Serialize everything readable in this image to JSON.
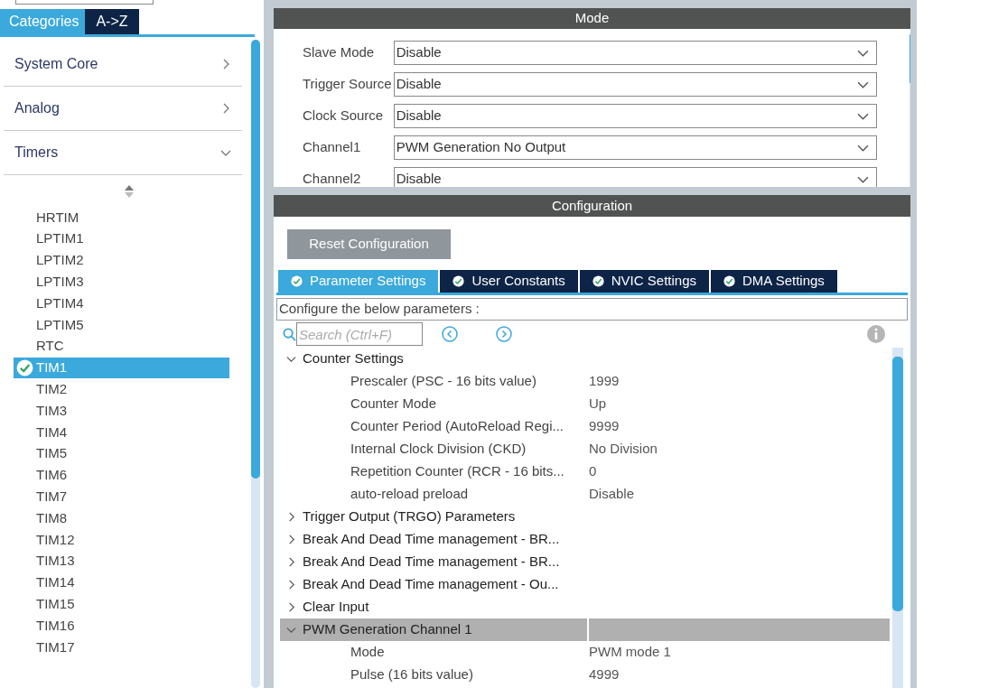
{
  "sidebar": {
    "tabs": [
      {
        "label": "Categories",
        "selected": true
      },
      {
        "label": "A->Z",
        "selected": false
      }
    ],
    "categories": [
      {
        "label": "System Core",
        "expanded": false
      },
      {
        "label": "Analog",
        "expanded": false
      },
      {
        "label": "Timers",
        "expanded": true
      }
    ],
    "items": [
      {
        "label": "HRTIM",
        "selected": false,
        "configured": false
      },
      {
        "label": "LPTIM1",
        "selected": false,
        "configured": false
      },
      {
        "label": "LPTIM2",
        "selected": false,
        "configured": false
      },
      {
        "label": "LPTIM3",
        "selected": false,
        "configured": false
      },
      {
        "label": "LPTIM4",
        "selected": false,
        "configured": false
      },
      {
        "label": "LPTIM5",
        "selected": false,
        "configured": false
      },
      {
        "label": "RTC",
        "selected": false,
        "configured": false
      },
      {
        "label": "TIM1",
        "selected": true,
        "configured": true
      },
      {
        "label": "TIM2",
        "selected": false,
        "configured": false
      },
      {
        "label": "TIM3",
        "selected": false,
        "configured": false
      },
      {
        "label": "TIM4",
        "selected": false,
        "configured": false
      },
      {
        "label": "TIM5",
        "selected": false,
        "configured": false
      },
      {
        "label": "TIM6",
        "selected": false,
        "configured": false
      },
      {
        "label": "TIM7",
        "selected": false,
        "configured": false
      },
      {
        "label": "TIM8",
        "selected": false,
        "configured": false
      },
      {
        "label": "TIM12",
        "selected": false,
        "configured": false
      },
      {
        "label": "TIM13",
        "selected": false,
        "configured": false
      },
      {
        "label": "TIM14",
        "selected": false,
        "configured": false
      },
      {
        "label": "TIM15",
        "selected": false,
        "configured": false
      },
      {
        "label": "TIM16",
        "selected": false,
        "configured": false
      },
      {
        "label": "TIM17",
        "selected": false,
        "configured": false
      }
    ]
  },
  "mode": {
    "title": "Mode",
    "fields": [
      {
        "label": "Slave Mode",
        "value": "Disable"
      },
      {
        "label": "Trigger Source",
        "value": "Disable"
      },
      {
        "label": "Clock Source",
        "value": "Disable"
      },
      {
        "label": "Channel1",
        "value": "PWM Generation No Output"
      },
      {
        "label": "Channel2",
        "value": "Disable"
      }
    ]
  },
  "configuration": {
    "title": "Configuration",
    "reset_button": "Reset Configuration",
    "tabs": [
      {
        "label": "Parameter Settings",
        "selected": true
      },
      {
        "label": "User Constants",
        "selected": false
      },
      {
        "label": "NVIC Settings",
        "selected": false
      },
      {
        "label": "DMA Settings",
        "selected": false
      }
    ],
    "hint": "Configure the below parameters :",
    "search": {
      "placeholder": "Search (Ctrl+F)"
    },
    "groups": [
      {
        "label": "Counter Settings",
        "expanded": true,
        "selected": false,
        "children": [
          {
            "label": "Prescaler (PSC - 16 bits value)",
            "value": "1999"
          },
          {
            "label": "Counter Mode",
            "value": "Up"
          },
          {
            "label": "Counter Period (AutoReload Regi...",
            "value": "9999"
          },
          {
            "label": "Internal Clock Division (CKD)",
            "value": "No Division"
          },
          {
            "label": "Repetition Counter (RCR - 16 bits...",
            "value": "0"
          },
          {
            "label": "auto-reload preload",
            "value": "Disable"
          }
        ]
      },
      {
        "label": "Trigger Output (TRGO) Parameters",
        "expanded": false,
        "selected": false
      },
      {
        "label": "Break And Dead Time management - BR...",
        "expanded": false,
        "selected": false
      },
      {
        "label": "Break And Dead Time management - BR...",
        "expanded": false,
        "selected": false
      },
      {
        "label": "Break And Dead Time management - Ou...",
        "expanded": false,
        "selected": false
      },
      {
        "label": "Clear Input",
        "expanded": false,
        "selected": false
      },
      {
        "label": "PWM Generation Channel 1",
        "expanded": true,
        "selected": true,
        "children": [
          {
            "label": "Mode",
            "value": "PWM mode 1"
          },
          {
            "label": "Pulse (16 bits value)",
            "value": "4999"
          }
        ]
      }
    ]
  }
}
